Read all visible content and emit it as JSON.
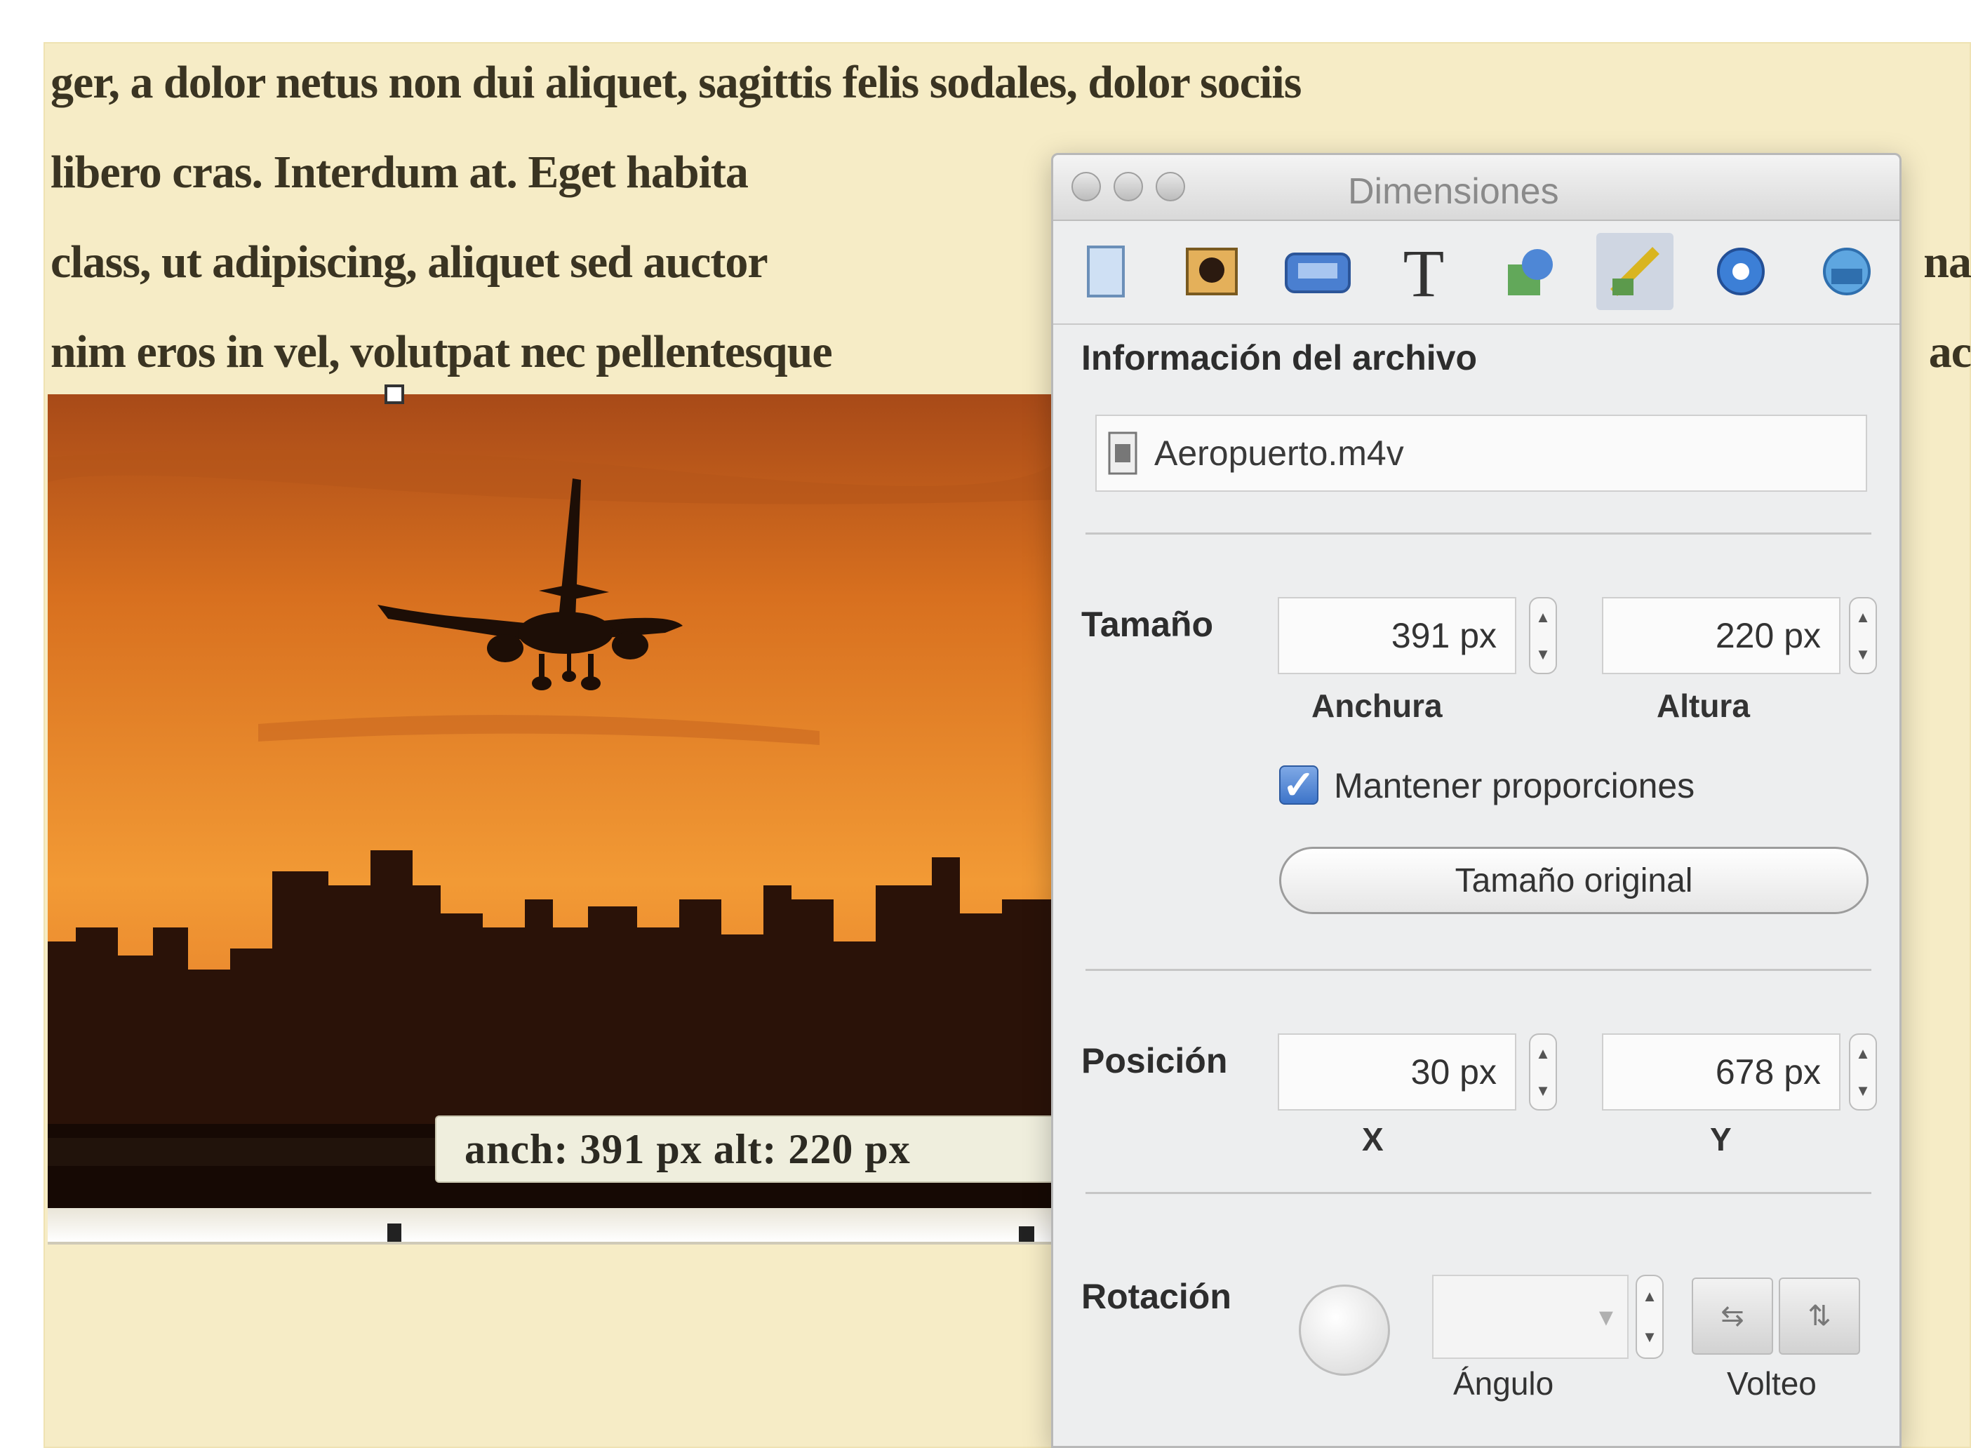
{
  "document": {
    "lines": [
      "ger, a dolor netus non dui aliquet, sagittis felis sodales, dolor sociis",
      "libero cras. Interdum at. Eget habita",
      "class, ut adipiscing, aliquet sed auctor",
      "nim eros in vel, volutpat nec pellentesque"
    ],
    "line3_tail": "na",
    "line4_tail": "ac"
  },
  "image_tooltip": "anch: 391 px   alt: 220 px",
  "panel": {
    "title": "Dimensiones",
    "toolbar_icons": [
      "document-icon",
      "image-icon",
      "layout-icon",
      "text-icon",
      "graphic-icon",
      "metrics-icon",
      "color-icon",
      "link-icon"
    ],
    "active_tool_index": 5,
    "file_info_label": "Información del archivo",
    "file_name": "Aeropuerto.m4v",
    "size": {
      "label": "Tamaño",
      "width_value": "391 px",
      "height_value": "220 px",
      "width_label": "Anchura",
      "height_label": "Altura",
      "keep_proportions_label": "Mantener proporciones",
      "keep_proportions_checked": true,
      "original_size_button": "Tamaño original"
    },
    "position": {
      "label": "Posición",
      "x_value": "30 px",
      "y_value": "678 px",
      "x_label": "X",
      "y_label": "Y"
    },
    "rotation": {
      "label": "Rotación",
      "angle_label": "Ángulo",
      "flip_label": "Volteo"
    }
  },
  "colors": {
    "page_background": "#f6ecc6",
    "sky_top": "#c8641e",
    "sky_mid": "#f0922c",
    "skyline": "#2a1208",
    "panel_background": "#edeeef",
    "checkbox_blue": "#3d74c9"
  }
}
